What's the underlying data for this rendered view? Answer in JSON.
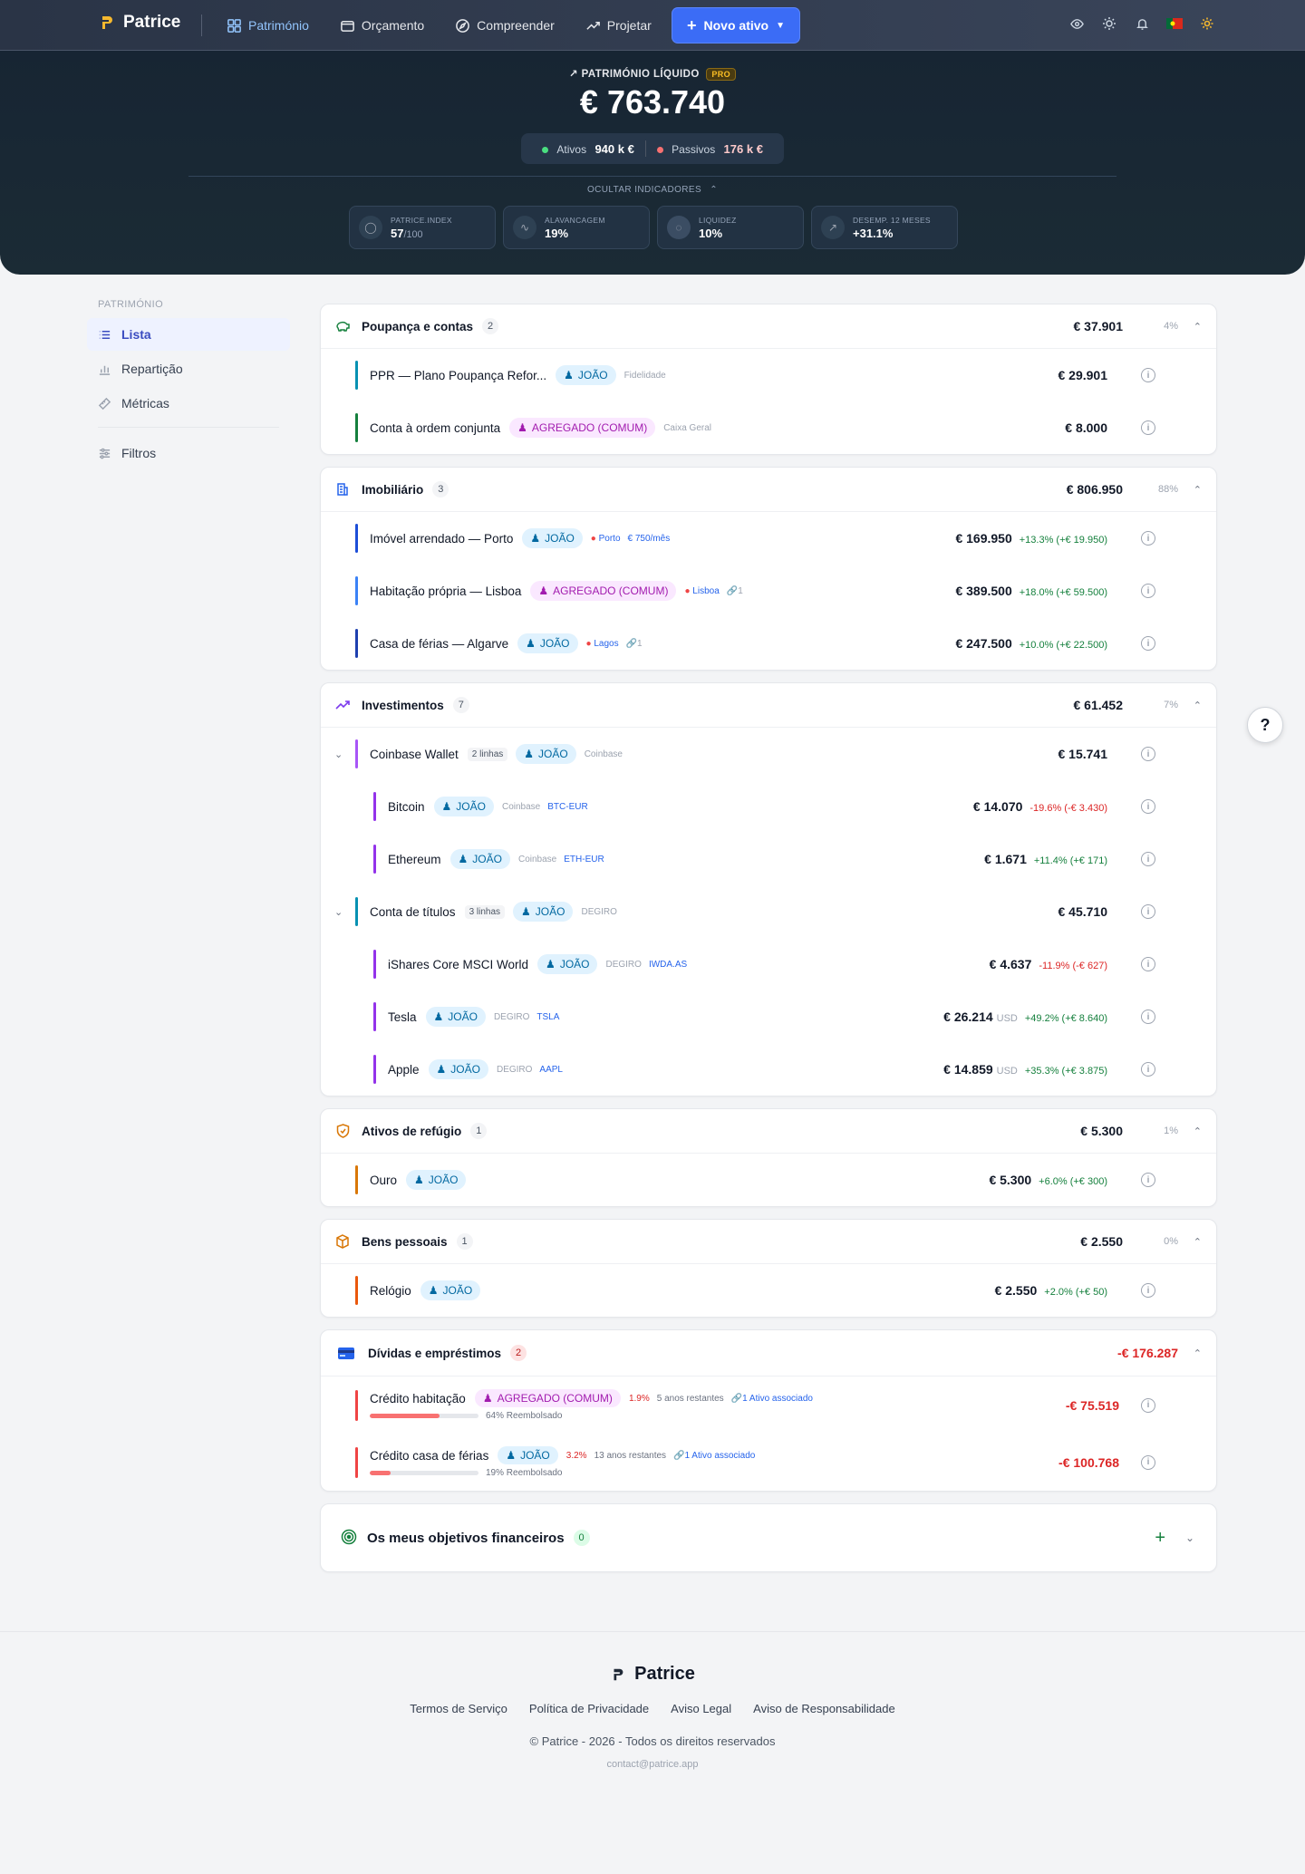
{
  "nav": {
    "brand": "Patrice",
    "items": [
      {
        "label": "Património",
        "icon": "grid-icon",
        "active": true
      },
      {
        "label": "Orçamento",
        "icon": "wallet-icon",
        "active": false
      },
      {
        "label": "Compreender",
        "icon": "compass-icon",
        "active": false
      },
      {
        "label": "Projetar",
        "icon": "trend-icon",
        "active": false
      }
    ],
    "new_button": "Novo ativo"
  },
  "hero": {
    "label": "PATRIMÓNIO LÍQUIDO",
    "pro": "PRO",
    "value": "€ 763.740",
    "assets_label": "Ativos",
    "assets_value": "940 k €",
    "liabilities_label": "Passivos",
    "liabilities_value": "176 k €",
    "toggle": "OCULTAR INDICADORES",
    "kpis": [
      {
        "label": "PATRICE.INDEX",
        "value": "57",
        "suffix": "/100"
      },
      {
        "label": "ALAVANCAGEM",
        "value": "19%",
        "suffix": ""
      },
      {
        "label": "LIQUIDEZ",
        "value": "10%",
        "suffix": ""
      },
      {
        "label": "DESEMP. 12 MESES",
        "value": "+31.1%",
        "suffix": ""
      }
    ]
  },
  "sidebar": {
    "heading": "PATRIMÓNIO",
    "items": [
      {
        "label": "Lista",
        "active": true
      },
      {
        "label": "Repartição",
        "active": false
      },
      {
        "label": "Métricas",
        "active": false
      }
    ],
    "filters": "Filtros"
  },
  "categories": {
    "savings": {
      "title": "Poupança e contas",
      "count": "2",
      "total": "€ 37.901",
      "pct": "4%",
      "rows": [
        {
          "name": "PPR — Plano Poupança Refor...",
          "owner": "JOÃO",
          "meta": "Fidelidade",
          "value": "€ 29.901"
        },
        {
          "name": "Conta à ordem conjunta",
          "owner": "AGREGADO (COMUM)",
          "meta": "Caixa Geral",
          "value": "€ 8.000"
        }
      ]
    },
    "realestate": {
      "title": "Imobiliário",
      "count": "3",
      "total": "€ 806.950",
      "pct": "88%",
      "rows": [
        {
          "name": "Imóvel arrendado — Porto",
          "owner": "JOÃO",
          "loc": "Porto",
          "extra": "€ 750/mês",
          "value": "€ 169.950",
          "chg": "+13.3% (+€ 19.950)"
        },
        {
          "name": "Habitação própria — Lisboa",
          "owner": "AGREGADO (COMUM)",
          "loc": "Lisboa",
          "link": "1",
          "value": "€ 389.500",
          "chg": "+18.0% (+€ 59.500)"
        },
        {
          "name": "Casa de férias — Algarve",
          "owner": "JOÃO",
          "loc": "Lagos",
          "link": "1",
          "value": "€ 247.500",
          "chg": "+10.0% (+€ 22.500)"
        }
      ]
    },
    "investments": {
      "title": "Investimentos",
      "count": "7",
      "total": "€ 61.452",
      "pct": "7%",
      "wallet": {
        "name": "Coinbase Wallet",
        "lines": "2 linhas",
        "owner": "JOÃO",
        "meta": "Coinbase",
        "value": "€ 15.741"
      },
      "wallet_rows": [
        {
          "name": "Bitcoin",
          "owner": "JOÃO",
          "meta": "Coinbase",
          "ticker": "BTC-EUR",
          "value": "€ 14.070",
          "chg": "-19.6% (-€ 3.430)"
        },
        {
          "name": "Ethereum",
          "owner": "JOÃO",
          "meta": "Coinbase",
          "ticker": "ETH-EUR",
          "value": "€ 1.671",
          "chg": "+11.4% (+€ 171)"
        }
      ],
      "broker": {
        "name": "Conta de títulos",
        "lines": "3 linhas",
        "owner": "JOÃO",
        "meta": "DEGIRO",
        "value": "€ 45.710"
      },
      "broker_rows": [
        {
          "name": "iShares Core MSCI World",
          "owner": "JOÃO",
          "meta": "DEGIRO",
          "ticker": "IWDA.AS",
          "value": "€ 4.637",
          "ccy": "",
          "chg": "-11.9% (-€ 627)"
        },
        {
          "name": "Tesla",
          "owner": "JOÃO",
          "meta": "DEGIRO",
          "ticker": "TSLA",
          "value": "€ 26.214",
          "ccy": "USD",
          "chg": "+49.2% (+€ 8.640)"
        },
        {
          "name": "Apple",
          "owner": "JOÃO",
          "meta": "DEGIRO",
          "ticker": "AAPL",
          "value": "€ 14.859",
          "ccy": "USD",
          "chg": "+35.3% (+€ 3.875)"
        }
      ]
    },
    "refuge": {
      "title": "Ativos de refúgio",
      "count": "1",
      "total": "€ 5.300",
      "pct": "1%",
      "rows": [
        {
          "name": "Ouro",
          "owner": "JOÃO",
          "value": "€ 5.300",
          "chg": "+6.0% (+€ 300)"
        }
      ]
    },
    "personal": {
      "title": "Bens pessoais",
      "count": "1",
      "total": "€ 2.550",
      "pct": "0%",
      "rows": [
        {
          "name": "Relógio",
          "owner": "JOÃO",
          "value": "€ 2.550",
          "chg": "+2.0% (+€ 50)"
        }
      ]
    },
    "debts": {
      "title": "Dívidas e empréstimos",
      "count": "2",
      "total": "-€ 176.287",
      "rows": [
        {
          "name": "Crédito habitação",
          "owner": "AGREGADO (COMUM)",
          "rate": "1.9%",
          "remaining": "5 anos restantes",
          "link": "1 Ativo associado",
          "repaid_label": "64% Reembolsado",
          "repaid": 0.64,
          "value": "-€ 75.519"
        },
        {
          "name": "Crédito casa de férias",
          "owner": "JOÃO",
          "rate": "3.2%",
          "remaining": "13 anos restantes",
          "link": "1 Ativo associado",
          "repaid_label": "19% Reembolsado",
          "repaid": 0.19,
          "value": "-€ 100.768"
        }
      ]
    }
  },
  "goals": {
    "title": "Os meus objetivos financeiros",
    "count": "0"
  },
  "help": "?",
  "footer": {
    "brand": "Patrice",
    "links": [
      "Termos de Serviço",
      "Política de Privacidade",
      "Aviso Legal",
      "Aviso de Responsabilidade"
    ],
    "copyright": "© Patrice - 2026 - Todos os direitos reservados",
    "email": "contact@patrice.app"
  },
  "colors": {
    "accent": "#3b6cf6",
    "positive": "#15803d",
    "negative": "#dc2626",
    "owner_tag": "#e0f2fe",
    "aggregate_tag": "#fae8ff"
  }
}
